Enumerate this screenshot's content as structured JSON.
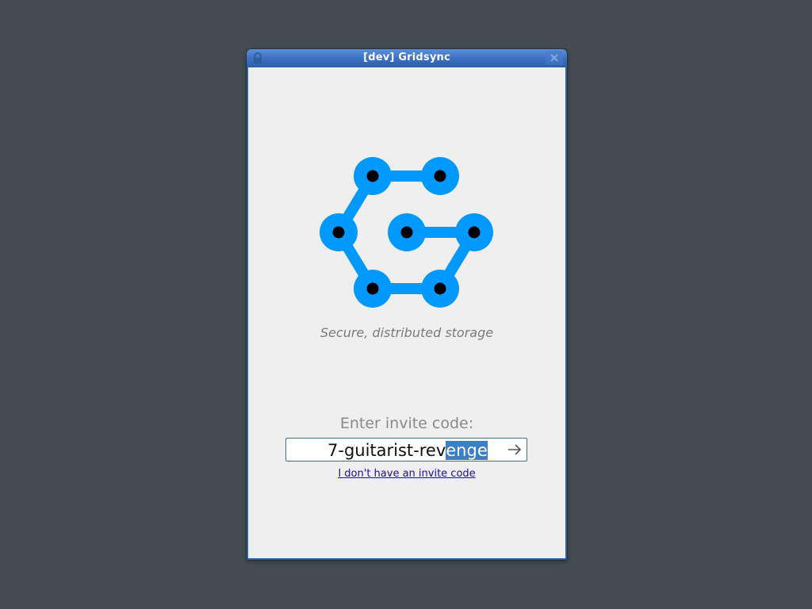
{
  "window": {
    "title": "[dev] Gridsync"
  },
  "icons": {
    "window_menu": "lock-icon",
    "close": "close-icon",
    "logo": "gridsync-logo",
    "submit": "arrow-right-icon"
  },
  "colors": {
    "logo_blue": "#0099ff",
    "logo_dot": "#000000",
    "selection": "#3b7fc4",
    "link": "#1a0dab"
  },
  "main": {
    "tagline": "Secure, distributed storage",
    "invite_label": "Enter invite code:",
    "invite_value_unselected": "7-guitarist-rev",
    "invite_value_selected": "enge",
    "no_code_link": "I don't have an invite code"
  }
}
